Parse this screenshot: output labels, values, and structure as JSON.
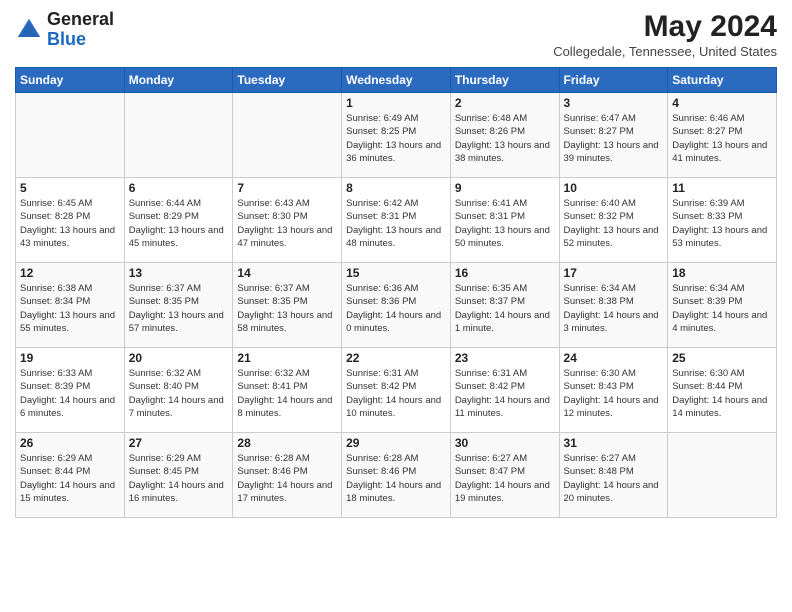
{
  "header": {
    "logo_line1": "General",
    "logo_line2": "Blue",
    "month_year": "May 2024",
    "location": "Collegedale, Tennessee, United States"
  },
  "days_of_week": [
    "Sunday",
    "Monday",
    "Tuesday",
    "Wednesday",
    "Thursday",
    "Friday",
    "Saturday"
  ],
  "weeks": [
    [
      {
        "day": "",
        "info": ""
      },
      {
        "day": "",
        "info": ""
      },
      {
        "day": "",
        "info": ""
      },
      {
        "day": "1",
        "info": "Sunrise: 6:49 AM\nSunset: 8:25 PM\nDaylight: 13 hours and 36 minutes."
      },
      {
        "day": "2",
        "info": "Sunrise: 6:48 AM\nSunset: 8:26 PM\nDaylight: 13 hours and 38 minutes."
      },
      {
        "day": "3",
        "info": "Sunrise: 6:47 AM\nSunset: 8:27 PM\nDaylight: 13 hours and 39 minutes."
      },
      {
        "day": "4",
        "info": "Sunrise: 6:46 AM\nSunset: 8:27 PM\nDaylight: 13 hours and 41 minutes."
      }
    ],
    [
      {
        "day": "5",
        "info": "Sunrise: 6:45 AM\nSunset: 8:28 PM\nDaylight: 13 hours and 43 minutes."
      },
      {
        "day": "6",
        "info": "Sunrise: 6:44 AM\nSunset: 8:29 PM\nDaylight: 13 hours and 45 minutes."
      },
      {
        "day": "7",
        "info": "Sunrise: 6:43 AM\nSunset: 8:30 PM\nDaylight: 13 hours and 47 minutes."
      },
      {
        "day": "8",
        "info": "Sunrise: 6:42 AM\nSunset: 8:31 PM\nDaylight: 13 hours and 48 minutes."
      },
      {
        "day": "9",
        "info": "Sunrise: 6:41 AM\nSunset: 8:31 PM\nDaylight: 13 hours and 50 minutes."
      },
      {
        "day": "10",
        "info": "Sunrise: 6:40 AM\nSunset: 8:32 PM\nDaylight: 13 hours and 52 minutes."
      },
      {
        "day": "11",
        "info": "Sunrise: 6:39 AM\nSunset: 8:33 PM\nDaylight: 13 hours and 53 minutes."
      }
    ],
    [
      {
        "day": "12",
        "info": "Sunrise: 6:38 AM\nSunset: 8:34 PM\nDaylight: 13 hours and 55 minutes."
      },
      {
        "day": "13",
        "info": "Sunrise: 6:37 AM\nSunset: 8:35 PM\nDaylight: 13 hours and 57 minutes."
      },
      {
        "day": "14",
        "info": "Sunrise: 6:37 AM\nSunset: 8:35 PM\nDaylight: 13 hours and 58 minutes."
      },
      {
        "day": "15",
        "info": "Sunrise: 6:36 AM\nSunset: 8:36 PM\nDaylight: 14 hours and 0 minutes."
      },
      {
        "day": "16",
        "info": "Sunrise: 6:35 AM\nSunset: 8:37 PM\nDaylight: 14 hours and 1 minute."
      },
      {
        "day": "17",
        "info": "Sunrise: 6:34 AM\nSunset: 8:38 PM\nDaylight: 14 hours and 3 minutes."
      },
      {
        "day": "18",
        "info": "Sunrise: 6:34 AM\nSunset: 8:39 PM\nDaylight: 14 hours and 4 minutes."
      }
    ],
    [
      {
        "day": "19",
        "info": "Sunrise: 6:33 AM\nSunset: 8:39 PM\nDaylight: 14 hours and 6 minutes."
      },
      {
        "day": "20",
        "info": "Sunrise: 6:32 AM\nSunset: 8:40 PM\nDaylight: 14 hours and 7 minutes."
      },
      {
        "day": "21",
        "info": "Sunrise: 6:32 AM\nSunset: 8:41 PM\nDaylight: 14 hours and 8 minutes."
      },
      {
        "day": "22",
        "info": "Sunrise: 6:31 AM\nSunset: 8:42 PM\nDaylight: 14 hours and 10 minutes."
      },
      {
        "day": "23",
        "info": "Sunrise: 6:31 AM\nSunset: 8:42 PM\nDaylight: 14 hours and 11 minutes."
      },
      {
        "day": "24",
        "info": "Sunrise: 6:30 AM\nSunset: 8:43 PM\nDaylight: 14 hours and 12 minutes."
      },
      {
        "day": "25",
        "info": "Sunrise: 6:30 AM\nSunset: 8:44 PM\nDaylight: 14 hours and 14 minutes."
      }
    ],
    [
      {
        "day": "26",
        "info": "Sunrise: 6:29 AM\nSunset: 8:44 PM\nDaylight: 14 hours and 15 minutes."
      },
      {
        "day": "27",
        "info": "Sunrise: 6:29 AM\nSunset: 8:45 PM\nDaylight: 14 hours and 16 minutes."
      },
      {
        "day": "28",
        "info": "Sunrise: 6:28 AM\nSunset: 8:46 PM\nDaylight: 14 hours and 17 minutes."
      },
      {
        "day": "29",
        "info": "Sunrise: 6:28 AM\nSunset: 8:46 PM\nDaylight: 14 hours and 18 minutes."
      },
      {
        "day": "30",
        "info": "Sunrise: 6:27 AM\nSunset: 8:47 PM\nDaylight: 14 hours and 19 minutes."
      },
      {
        "day": "31",
        "info": "Sunrise: 6:27 AM\nSunset: 8:48 PM\nDaylight: 14 hours and 20 minutes."
      },
      {
        "day": "",
        "info": ""
      }
    ]
  ]
}
